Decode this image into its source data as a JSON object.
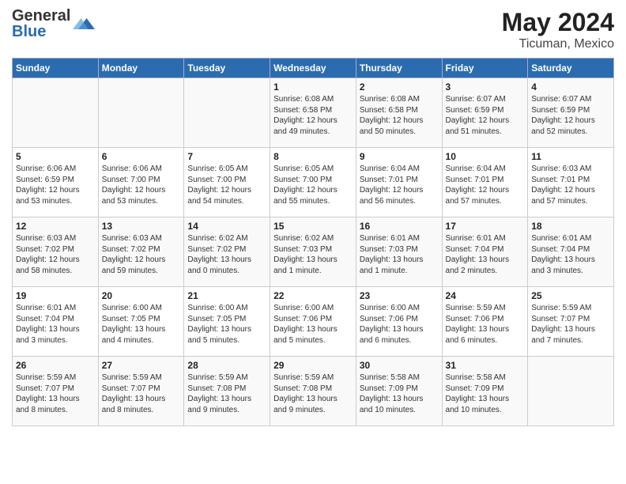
{
  "header": {
    "logo_line1": "General",
    "logo_line2": "Blue",
    "month": "May 2024",
    "location": "Ticuman, Mexico"
  },
  "weekdays": [
    "Sunday",
    "Monday",
    "Tuesday",
    "Wednesday",
    "Thursday",
    "Friday",
    "Saturday"
  ],
  "weeks": [
    [
      {
        "day": "",
        "info": ""
      },
      {
        "day": "",
        "info": ""
      },
      {
        "day": "",
        "info": ""
      },
      {
        "day": "1",
        "info": "Sunrise: 6:08 AM\nSunset: 6:58 PM\nDaylight: 12 hours\nand 49 minutes."
      },
      {
        "day": "2",
        "info": "Sunrise: 6:08 AM\nSunset: 6:58 PM\nDaylight: 12 hours\nand 50 minutes."
      },
      {
        "day": "3",
        "info": "Sunrise: 6:07 AM\nSunset: 6:59 PM\nDaylight: 12 hours\nand 51 minutes."
      },
      {
        "day": "4",
        "info": "Sunrise: 6:07 AM\nSunset: 6:59 PM\nDaylight: 12 hours\nand 52 minutes."
      }
    ],
    [
      {
        "day": "5",
        "info": "Sunrise: 6:06 AM\nSunset: 6:59 PM\nDaylight: 12 hours\nand 53 minutes."
      },
      {
        "day": "6",
        "info": "Sunrise: 6:06 AM\nSunset: 7:00 PM\nDaylight: 12 hours\nand 53 minutes."
      },
      {
        "day": "7",
        "info": "Sunrise: 6:05 AM\nSunset: 7:00 PM\nDaylight: 12 hours\nand 54 minutes."
      },
      {
        "day": "8",
        "info": "Sunrise: 6:05 AM\nSunset: 7:00 PM\nDaylight: 12 hours\nand 55 minutes."
      },
      {
        "day": "9",
        "info": "Sunrise: 6:04 AM\nSunset: 7:01 PM\nDaylight: 12 hours\nand 56 minutes."
      },
      {
        "day": "10",
        "info": "Sunrise: 6:04 AM\nSunset: 7:01 PM\nDaylight: 12 hours\nand 57 minutes."
      },
      {
        "day": "11",
        "info": "Sunrise: 6:03 AM\nSunset: 7:01 PM\nDaylight: 12 hours\nand 57 minutes."
      }
    ],
    [
      {
        "day": "12",
        "info": "Sunrise: 6:03 AM\nSunset: 7:02 PM\nDaylight: 12 hours\nand 58 minutes."
      },
      {
        "day": "13",
        "info": "Sunrise: 6:03 AM\nSunset: 7:02 PM\nDaylight: 12 hours\nand 59 minutes."
      },
      {
        "day": "14",
        "info": "Sunrise: 6:02 AM\nSunset: 7:02 PM\nDaylight: 13 hours\nand 0 minutes."
      },
      {
        "day": "15",
        "info": "Sunrise: 6:02 AM\nSunset: 7:03 PM\nDaylight: 13 hours\nand 1 minute."
      },
      {
        "day": "16",
        "info": "Sunrise: 6:01 AM\nSunset: 7:03 PM\nDaylight: 13 hours\nand 1 minute."
      },
      {
        "day": "17",
        "info": "Sunrise: 6:01 AM\nSunset: 7:04 PM\nDaylight: 13 hours\nand 2 minutes."
      },
      {
        "day": "18",
        "info": "Sunrise: 6:01 AM\nSunset: 7:04 PM\nDaylight: 13 hours\nand 3 minutes."
      }
    ],
    [
      {
        "day": "19",
        "info": "Sunrise: 6:01 AM\nSunset: 7:04 PM\nDaylight: 13 hours\nand 3 minutes."
      },
      {
        "day": "20",
        "info": "Sunrise: 6:00 AM\nSunset: 7:05 PM\nDaylight: 13 hours\nand 4 minutes."
      },
      {
        "day": "21",
        "info": "Sunrise: 6:00 AM\nSunset: 7:05 PM\nDaylight: 13 hours\nand 5 minutes."
      },
      {
        "day": "22",
        "info": "Sunrise: 6:00 AM\nSunset: 7:06 PM\nDaylight: 13 hours\nand 5 minutes."
      },
      {
        "day": "23",
        "info": "Sunrise: 6:00 AM\nSunset: 7:06 PM\nDaylight: 13 hours\nand 6 minutes."
      },
      {
        "day": "24",
        "info": "Sunrise: 5:59 AM\nSunset: 7:06 PM\nDaylight: 13 hours\nand 6 minutes."
      },
      {
        "day": "25",
        "info": "Sunrise: 5:59 AM\nSunset: 7:07 PM\nDaylight: 13 hours\nand 7 minutes."
      }
    ],
    [
      {
        "day": "26",
        "info": "Sunrise: 5:59 AM\nSunset: 7:07 PM\nDaylight: 13 hours\nand 8 minutes."
      },
      {
        "day": "27",
        "info": "Sunrise: 5:59 AM\nSunset: 7:07 PM\nDaylight: 13 hours\nand 8 minutes."
      },
      {
        "day": "28",
        "info": "Sunrise: 5:59 AM\nSunset: 7:08 PM\nDaylight: 13 hours\nand 9 minutes."
      },
      {
        "day": "29",
        "info": "Sunrise: 5:59 AM\nSunset: 7:08 PM\nDaylight: 13 hours\nand 9 minutes."
      },
      {
        "day": "30",
        "info": "Sunrise: 5:58 AM\nSunset: 7:09 PM\nDaylight: 13 hours\nand 10 minutes."
      },
      {
        "day": "31",
        "info": "Sunrise: 5:58 AM\nSunset: 7:09 PM\nDaylight: 13 hours\nand 10 minutes."
      },
      {
        "day": "",
        "info": ""
      }
    ]
  ]
}
